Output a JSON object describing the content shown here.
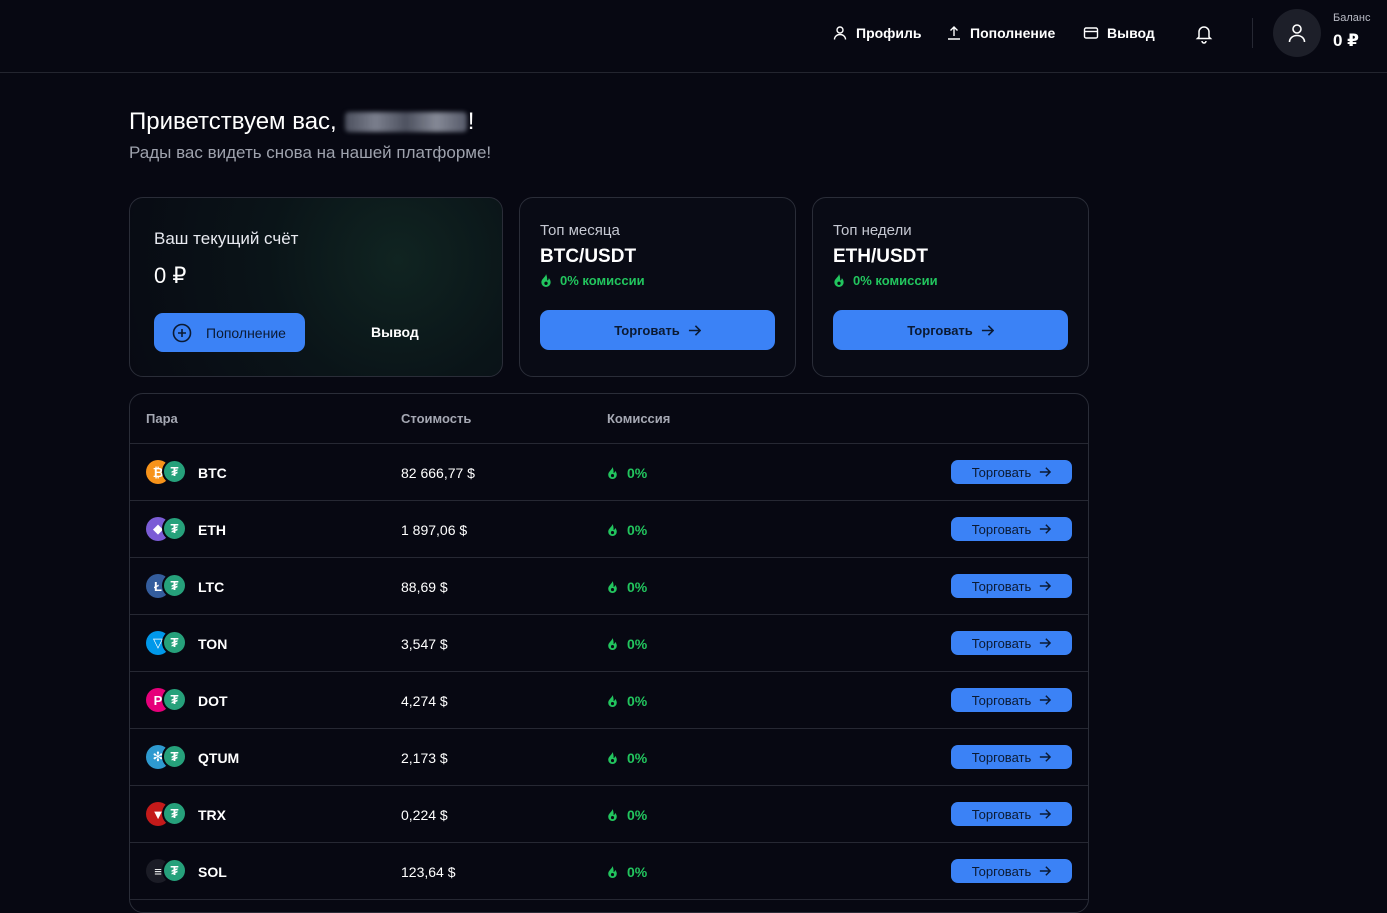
{
  "header": {
    "nav": [
      {
        "label": "Профиль",
        "icon": "user-icon"
      },
      {
        "label": "Пополнение",
        "icon": "upload-icon"
      },
      {
        "label": "Вывод",
        "icon": "card-icon"
      }
    ],
    "balance_label": "Баланс",
    "balance_value": "0 ₽"
  },
  "greeting": {
    "title": "Приветствуем вас,",
    "suffix": "!",
    "subtitle": "Рады вас видеть снова на нашей платформе!"
  },
  "account": {
    "label": "Ваш текущий счёт",
    "value": "0 ₽",
    "deposit_label": "Пополнение",
    "withdraw_label": "Вывод"
  },
  "top_month": {
    "label": "Топ месяца",
    "pair": "BTC/USDT",
    "fee": "0% комиссии",
    "button": "Торговать"
  },
  "top_week": {
    "label": "Топ недели",
    "pair": "ETH/USDT",
    "fee": "0% комиссии",
    "button": "Торговать"
  },
  "table": {
    "headers": [
      "Пара",
      "Стоимость",
      "Комиссия"
    ],
    "rows": [
      {
        "symbol": "BTC",
        "price": "82 666,77 $",
        "fee": "0%",
        "button": "Торговать"
      },
      {
        "symbol": "ETH",
        "price": "1 897,06 $",
        "fee": "0%",
        "button": "Торговать"
      },
      {
        "symbol": "LTC",
        "price": "88,69 $",
        "fee": "0%",
        "button": "Торговать"
      },
      {
        "symbol": "TON",
        "price": "3,547 $",
        "fee": "0%",
        "button": "Торговать"
      },
      {
        "symbol": "DOT",
        "price": "4,274 $",
        "fee": "0%",
        "button": "Торговать"
      },
      {
        "symbol": "QTUM",
        "price": "2,173 $",
        "fee": "0%",
        "button": "Торговать"
      },
      {
        "symbol": "TRX",
        "price": "0,224 $",
        "fee": "0%",
        "button": "Торговать"
      },
      {
        "symbol": "SOL",
        "price": "123,64 $",
        "fee": "0%",
        "button": "Торговать"
      }
    ]
  },
  "colors": {
    "accent": "#3b82f6",
    "success": "#22c55e",
    "background": "#070812",
    "tether": "#26a17b"
  }
}
